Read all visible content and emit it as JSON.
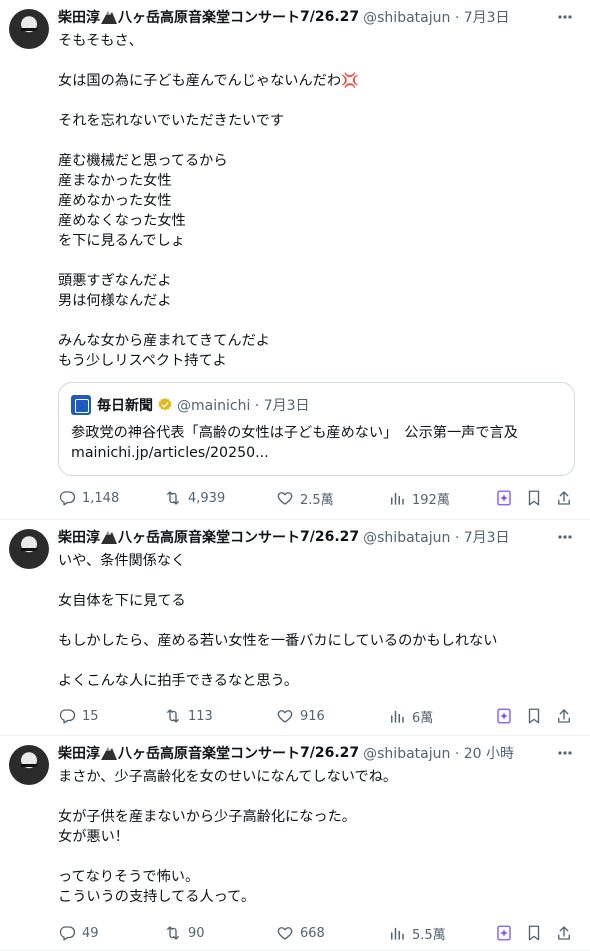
{
  "tweets": [
    {
      "author_name": "柴田淳",
      "author_suffix": "八ヶ岳高原音楽堂コンサート",
      "author_date": "7/26.27",
      "handle": "@shibatajun",
      "sep": " · ",
      "time": "7月3日",
      "lines": [
        "そもそもさ、",
        "",
        "女は国の為に子ども産んでんじゃないんだわ💢",
        "",
        "それを忘れないでいただきたいです",
        "",
        "産む機械だと思ってるから",
        "産まなかった女性",
        "産めなかった女性",
        "産めなくなった女性",
        "を下に見るんでしょ",
        "",
        "頭悪すぎなんだよ",
        "男は何様なんだよ",
        "",
        "みんな女から産まれてきてんだよ",
        "もう少しリスペクト持てよ"
      ],
      "quote": {
        "name": "毎日新聞",
        "handle": "@mainichi",
        "sep": " · ",
        "time": "7月3日",
        "text1": "参政党の神谷代表「高齢の女性は子ども産めない」　公示第一声で言及",
        "text2": "mainichi.jp/articles/20250..."
      },
      "replies": "1,148",
      "reposts": "4,939",
      "likes": "2.5萬",
      "views": "192萬"
    },
    {
      "author_name": "柴田淳",
      "author_suffix": "八ヶ岳高原音楽堂コンサート",
      "author_date": "7/26.27",
      "handle": "@shibatajun",
      "sep": " · ",
      "time": "7月3日",
      "lines": [
        "いや、条件関係なく",
        "",
        "女自体を下に見てる",
        "",
        "もしかしたら、産める若い女性を一番バカにしているのかもしれない",
        "",
        "よくこんな人に拍手できるなと思う。"
      ],
      "replies": "15",
      "reposts": "113",
      "likes": "916",
      "views": "6萬"
    },
    {
      "author_name": "柴田淳",
      "author_suffix": "八ヶ岳高原音楽堂コンサート",
      "author_date": "7/26.27",
      "handle": "@shibatajun",
      "sep": " · ",
      "time": "20 小時",
      "lines": [
        "まさか、少子高齢化を女のせいになんてしないでね。",
        "",
        "女が子供を産まないから少子高齢化になった。",
        "女が悪い！",
        "",
        "ってなりそうで怖い。",
        "こういうの支持してる人って。"
      ],
      "replies": "49",
      "reposts": "90",
      "likes": "668",
      "views": "5.5萬"
    }
  ],
  "colors": {
    "text": "#0f1419",
    "muted": "#536471",
    "grok": "#7856ff",
    "border": "#cfd9de"
  },
  "icons": [
    "more-icon",
    "reply-icon",
    "repost-icon",
    "like-icon",
    "views-icon",
    "grok-icon",
    "bookmark-icon",
    "share-icon",
    "mountain-icon",
    "verified-icon"
  ]
}
